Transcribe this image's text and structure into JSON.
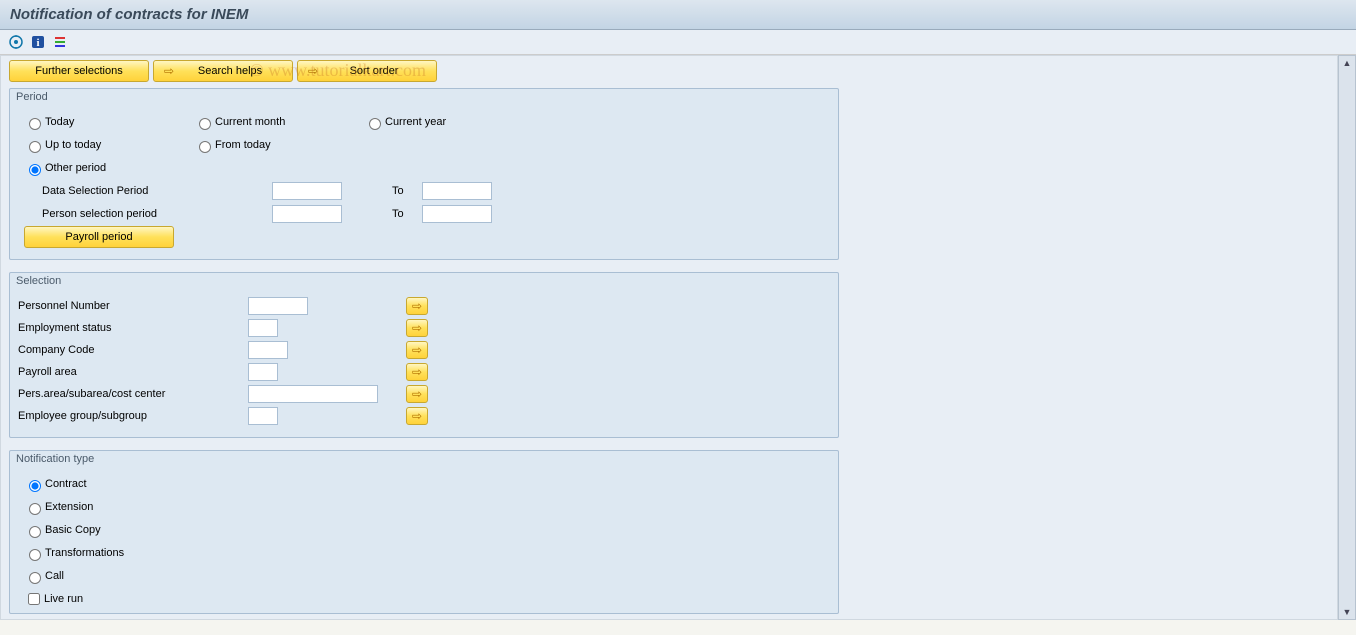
{
  "header": {
    "title": "Notification of contracts for INEM"
  },
  "watermark": "© www.tutorialkart.com",
  "buttons": {
    "further": "Further selections",
    "search": "Search helps",
    "sort": "Sort order",
    "payroll": "Payroll period"
  },
  "period": {
    "title": "Period",
    "today": "Today",
    "uptoday": "Up to today",
    "other": "Other period",
    "curmonth": "Current month",
    "fromtoday": "From today",
    "curyear": "Current year",
    "dsp": "Data Selection Period",
    "psp": "Person selection period",
    "to": "To"
  },
  "selection": {
    "title": "Selection",
    "pn": "Personnel Number",
    "es": "Employment status",
    "cc": "Company Code",
    "pa": "Payroll area",
    "area": "Pers.area/subarea/cost center",
    "eg": "Employee group/subgroup"
  },
  "ntype": {
    "title": "Notification type",
    "contract": "Contract",
    "ext": "Extension",
    "basic": "Basic Copy",
    "trans": "Transformations",
    "call": "Call",
    "live": "Live run"
  }
}
